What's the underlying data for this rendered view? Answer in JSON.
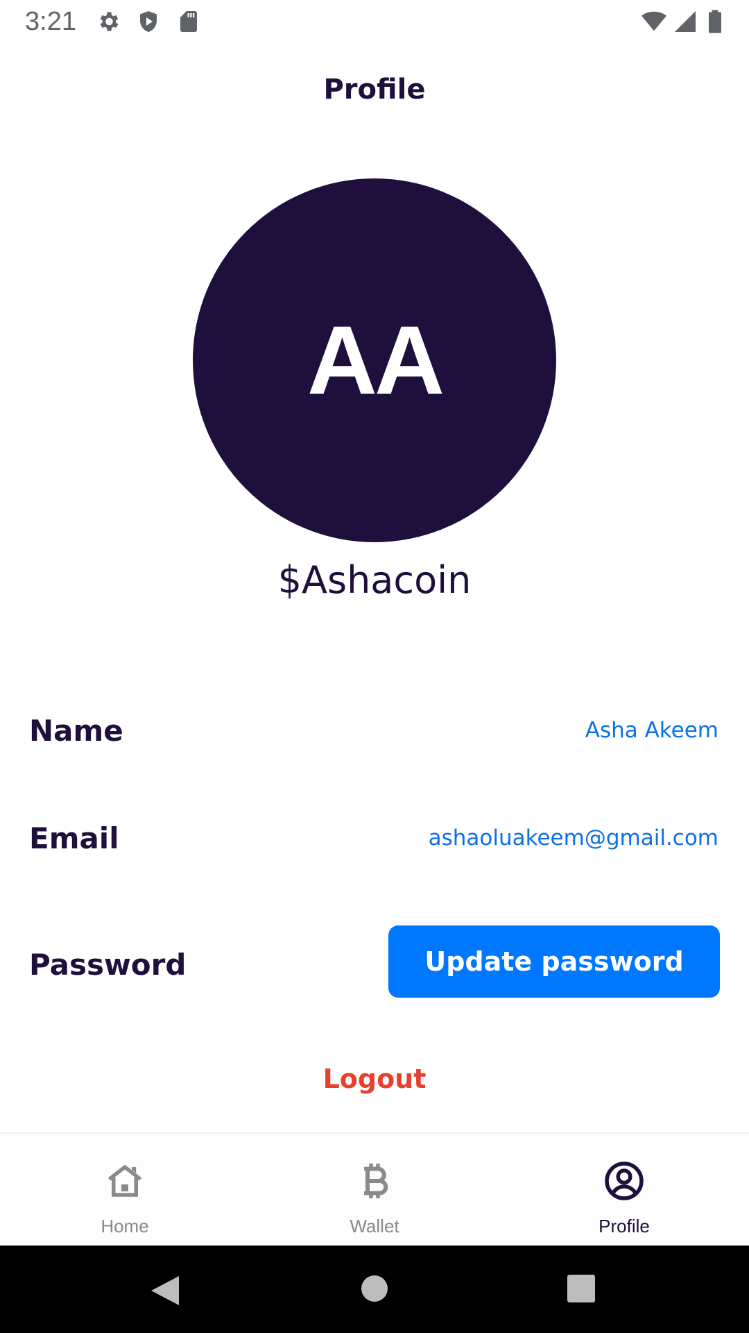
{
  "status_bar": {
    "time": "3:21",
    "left_icons": [
      "gear-icon",
      "shield-icon",
      "sd-card-icon"
    ],
    "right_icons": [
      "wifi-icon",
      "cell-signal-icon",
      "battery-icon"
    ]
  },
  "header": {
    "title": "Profile"
  },
  "profile": {
    "initials": "AA",
    "username": "$Ashacoin",
    "avatar_color": "#1f0f3d"
  },
  "details": {
    "name_label": "Name",
    "name_value": "Asha Akeem",
    "email_label": "Email",
    "email_value": "ashaoluakeem@gmail.com",
    "password_label": "Password",
    "update_password_label": "Update password"
  },
  "logout_label": "Logout",
  "bottom_nav": {
    "items": [
      {
        "label": "Home",
        "icon": "home-icon",
        "active": false
      },
      {
        "label": "Wallet",
        "icon": "bitcoin-icon",
        "active": false
      },
      {
        "label": "Profile",
        "icon": "user-circle-icon",
        "active": true
      }
    ]
  },
  "colors": {
    "primary_dark": "#1f0f3d",
    "accent_blue": "#0077ff",
    "logout_red": "#e8402f"
  }
}
